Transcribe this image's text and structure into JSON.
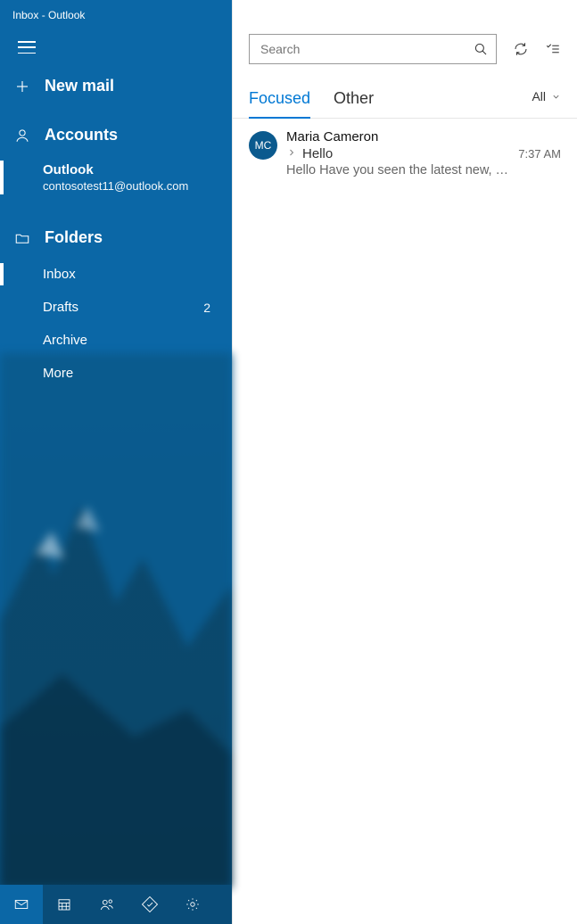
{
  "window": {
    "title": "Inbox - Outlook"
  },
  "sidebar": {
    "new_mail": "New mail",
    "accounts_header": "Accounts",
    "account": {
      "name": "Outlook",
      "email": "contosotest11@outlook.com"
    },
    "folders_header": "Folders",
    "folders": [
      {
        "label": "Inbox",
        "badge": "",
        "active": true
      },
      {
        "label": "Drafts",
        "badge": "2",
        "active": false
      },
      {
        "label": "Archive",
        "badge": "",
        "active": false
      },
      {
        "label": "More",
        "badge": "",
        "active": false
      }
    ],
    "bottom_tabs": [
      "mail",
      "calendar",
      "people",
      "tasks",
      "settings"
    ]
  },
  "toolbar": {
    "search_placeholder": "Search"
  },
  "tabs": {
    "items": [
      "Focused",
      "Other"
    ],
    "active_index": 0,
    "filter_label": "All"
  },
  "messages": [
    {
      "avatar_initials": "MC",
      "sender": "Maria Cameron",
      "subject": "Hello",
      "time": "7:37 AM",
      "preview": "Hello Have you seen the latest new, …"
    }
  ]
}
